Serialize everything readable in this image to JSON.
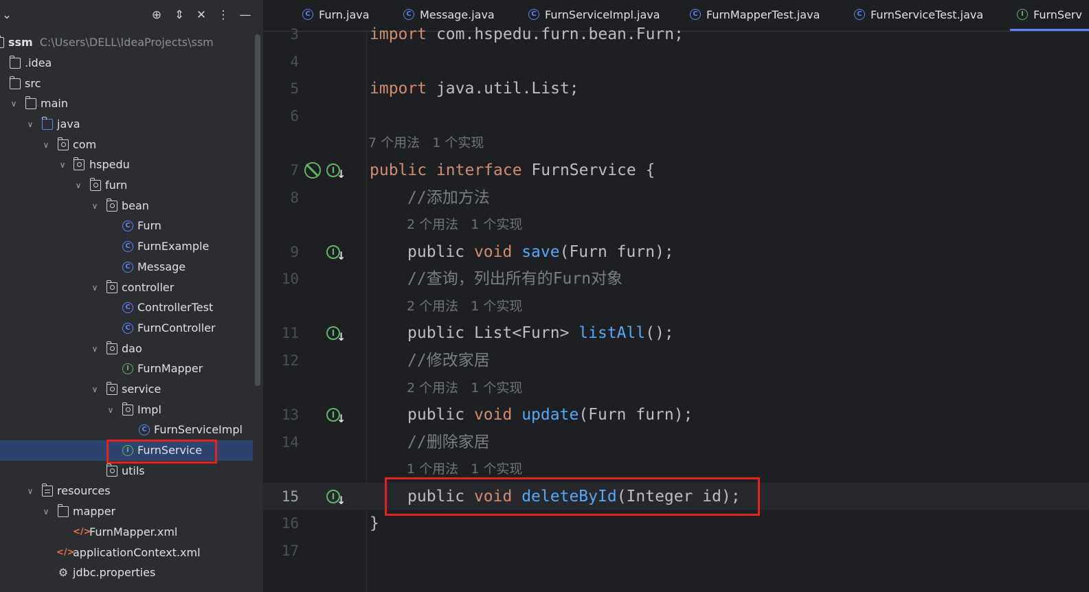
{
  "project": {
    "name": "ssm",
    "path": "C:\\Users\\DELL\\IdeaProjects\\ssm"
  },
  "toolbar_icons": [
    "chevron-down-icon",
    "locate-icon",
    "expand-collapse-icon",
    "close-icon",
    "more-icon",
    "minimize-icon"
  ],
  "tree": [
    {
      "label": ".idea",
      "icon": "folder"
    },
    {
      "label": "src",
      "icon": "folder"
    },
    {
      "label": "main",
      "icon": "folder"
    },
    {
      "label": "java",
      "icon": "source-folder"
    },
    {
      "label": "com",
      "icon": "package"
    },
    {
      "label": "hspedu",
      "icon": "package"
    },
    {
      "label": "furn",
      "icon": "package"
    },
    {
      "label": "bean",
      "icon": "package"
    },
    {
      "label": "Furn",
      "icon": "class"
    },
    {
      "label": "FurnExample",
      "icon": "class"
    },
    {
      "label": "Message",
      "icon": "class"
    },
    {
      "label": "controller",
      "icon": "package"
    },
    {
      "label": "ControllerTest",
      "icon": "class"
    },
    {
      "label": "FurnController",
      "icon": "class"
    },
    {
      "label": "dao",
      "icon": "package"
    },
    {
      "label": "FurnMapper",
      "icon": "interface"
    },
    {
      "label": "service",
      "icon": "package"
    },
    {
      "label": "Impl",
      "icon": "package"
    },
    {
      "label": "FurnServiceImpl",
      "icon": "class"
    },
    {
      "label": "FurnService",
      "icon": "interface"
    },
    {
      "label": "utils",
      "icon": "package"
    },
    {
      "label": "resources",
      "icon": "resources-folder"
    },
    {
      "label": "mapper",
      "icon": "folder"
    },
    {
      "label": "FurnMapper.xml",
      "icon": "xml"
    },
    {
      "label": "applicationContext.xml",
      "icon": "xml"
    },
    {
      "label": "jdbc.properties",
      "icon": "properties"
    }
  ],
  "tabs": [
    {
      "label": "Furn.java",
      "icon": "class"
    },
    {
      "label": "Message.java",
      "icon": "class"
    },
    {
      "label": "FurnServiceImpl.java",
      "icon": "class"
    },
    {
      "label": "FurnMapperTest.java",
      "icon": "class"
    },
    {
      "label": "FurnServiceTest.java",
      "icon": "class"
    },
    {
      "label": "FurnServ",
      "icon": "interface"
    }
  ],
  "editor": {
    "line3": {
      "num": "3",
      "kw": "import",
      "rest": " com.hspedu.furn.bean.Furn;"
    },
    "line4": {
      "num": "4"
    },
    "line5": {
      "num": "5",
      "kw": "import",
      "rest": " java.util.List;"
    },
    "line6": {
      "num": "6"
    },
    "hint_interface": "7 个用法   1 个实现",
    "line7": {
      "num": "7",
      "kw": "public interface",
      "name": "FurnService",
      "rest": " {"
    },
    "line8": {
      "num": "8",
      "comment": "//添加方法"
    },
    "hint_save": "2 个用法   1 个实现",
    "line9": {
      "num": "9",
      "kw1": "public",
      "kw2": "void",
      "fn": "save",
      "rest": "(Furn furn);"
    },
    "line10": {
      "num": "10",
      "comment": "//查询，列出所有的Furn对象"
    },
    "hint_list": "2 个用法   1 个实现",
    "line11": {
      "num": "11",
      "kw1": "public",
      "type": "List<Furn>",
      "fn": "listAll",
      "rest": "();"
    },
    "line12": {
      "num": "12",
      "comment": "//修改家居"
    },
    "hint_update": "2 个用法   1 个实现",
    "line13": {
      "num": "13",
      "kw1": "public",
      "kw2": "void",
      "fn": "update",
      "rest": "(Furn furn);"
    },
    "line14": {
      "num": "14",
      "comment": "//删除家居"
    },
    "hint_delete": "1 个用法   1 个实现",
    "line15": {
      "num": "15",
      "kw1": "public",
      "kw2": "void",
      "fn": "deleteById",
      "rest": "(Integer id);"
    },
    "line16": {
      "num": "16",
      "rest": "}"
    },
    "line17": {
      "num": "17"
    }
  },
  "colors": {
    "accent": "#548af7",
    "highlight_box": "#e5231b",
    "keyword": "#cf8e6d",
    "function": "#56a8f5"
  }
}
